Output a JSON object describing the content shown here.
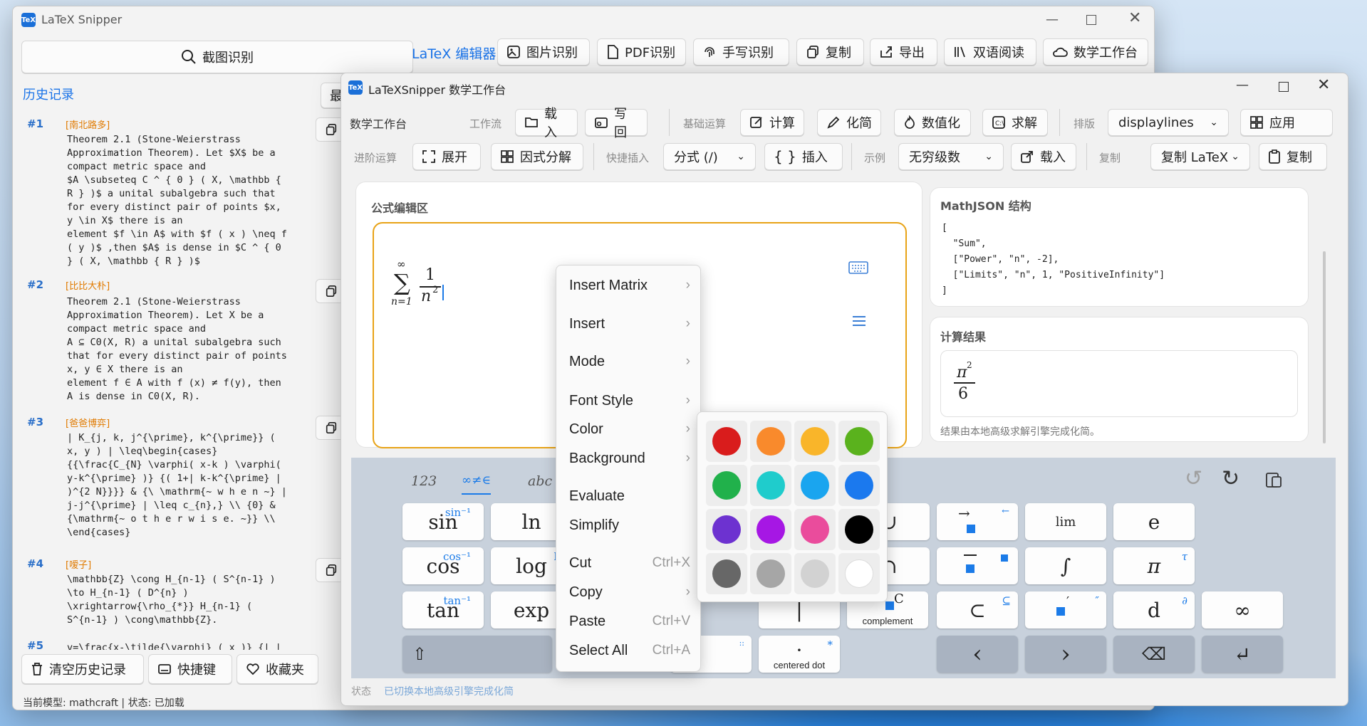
{
  "main": {
    "title": "LaTeX Snipper",
    "capture_btn": "截图识别",
    "editor_link": "LaTeX 编辑器",
    "toolbar": [
      "图片识别",
      "PDF识别",
      "手写识别",
      "复制",
      "导出",
      "双语阅读",
      "数学工作台"
    ],
    "history_title": "历史记录",
    "history_btn_partial": "最",
    "history": [
      {
        "num": "#1",
        "tag": "[南北路多]",
        "text": "Theorem 2.1 (Stone-Weierstrass\nApproximation Theorem). Let $X$ be a\ncompact metric space and\n$A \\subseteq C ^ { 0 } ( X, \\mathbb {\nR } )$ a unital subalgebra such that\nfor every distinct pair of points $x,\ny \\in X$ there is an\nelement $f \\in A$ with $f ( x ) \\neq f\n( y )$ ,then $A$ is dense in $C ^ { 0\n} ( X, \\mathbb { R } )$"
      },
      {
        "num": "#2",
        "tag": "[比比大朴]",
        "text": "Theorem 2.1 (Stone-Weierstrass\nApproximation Theorem). Let X be a\ncompact metric space and\nA ⊆ C0(X, R) a unital subalgebra such\nthat for every distinct pair of points\nx, y ∈ X there is an\nelement f ∈ A with f (x) ≠ f(y), then\nA is dense in C0(X, R)."
      },
      {
        "num": "#3",
        "tag": "[爸爸博弈]",
        "text": "| K_{j, k, j^{\\prime}, k^{\\prime}} (\nx, y ) | \\leq\\begin{cases}\n{{\\frac{C_{N} \\varphi( x-k ) \\varphi(\ny-k^{\\prime} )} {( 1+| k-k^{\\prime} |\n)^{2 N}}}} & {\\ \\mathrm{~ w h e n ~} |\nj-j^{\\prime} | \\leq c_{n},} \\\\ {0} &\n{\\mathrm{~ o t h e r w i s e. ~}} \\\\\n\\end{cases}"
      },
      {
        "num": "#4",
        "tag": "[嗳子]",
        "text": "\\mathbb{Z} \\cong H_{n-1} ( S^{n-1} )\n\\to H_{n-1} ( D^{n} )\n\\xrightarrow{\\rho_{*}} H_{n-1} (\nS^{n-1} ) \\cong\\mathbb{Z}."
      },
      {
        "num": "#5",
        "tag": "",
        "text": "v=\\frac{x-\\tilde{\\varphi} ( x )} {| |"
      }
    ],
    "bottom_btns": [
      "清空历史记录",
      "快捷键",
      "收藏夹"
    ],
    "status": "当前模型: mathcraft | 状态: 已加载"
  },
  "ws": {
    "title": "LaTeXSnipper 数学工作台",
    "row1_title": "数学工作台",
    "lbl_workflow": "工作流",
    "btn_load": "载入",
    "btn_writeback": "写回",
    "lbl_basic": "基础运算",
    "btn_calc": "计算",
    "btn_simplify": "化简",
    "btn_numeric": "数值化",
    "btn_solve": "求解",
    "lbl_layout": "排版",
    "layout_value": "displaylines",
    "btn_apply": "应用",
    "lbl_advanced": "进阶运算",
    "btn_expand": "展开",
    "btn_factor": "因式分解",
    "lbl_quick": "快捷插入",
    "quick_value": "分式 (/)",
    "btn_insert": "插入",
    "lbl_example": "示例",
    "example_value": "无穷级数",
    "btn_load2": "载入",
    "lbl_copy": "复制",
    "copy_value": "复制 LaTeX",
    "btn_copy": "复制",
    "editor_title": "公式编辑区",
    "formula": {
      "top": "∞",
      "sigma": "∑",
      "bottom": "n=1",
      "num": "1",
      "den": "n",
      "exp": "2"
    },
    "mathjson_title": "MathJSON 结构",
    "mathjson": "[\n  \"Sum\",\n  [\"Power\", \"n\", -2],\n  [\"Limits\", \"n\", 1, \"PositiveInfinity\"]\n]",
    "result_title": "计算结果",
    "result": {
      "num": "π",
      "exp": "2",
      "den": "6"
    },
    "result_note": "结果由本地高级求解引擎完成化简。",
    "status_label": "状态",
    "status_text": "已切换本地高级引擎完成化简"
  },
  "kb": {
    "tabs": [
      "123",
      "∞≠∈",
      "abc"
    ],
    "keys": [
      {
        "t": "sin",
        "s": "sin⁻¹"
      },
      {
        "t": "ln",
        "s": ""
      },
      {
        "t": "∪",
        "s": ""
      },
      {
        "t": "",
        "s": ""
      },
      {
        "t": "lim",
        "s": ""
      },
      {
        "t": "e",
        "s": ""
      },
      {
        "t": "cos",
        "s": "cos⁻¹"
      },
      {
        "t": "log",
        "s": "log"
      },
      {
        "t": "∩",
        "s": ""
      },
      {
        "t": "",
        "s": ""
      },
      {
        "t": "∫",
        "s": ""
      },
      {
        "t": "π",
        "s": "τ"
      },
      {
        "t": "tan",
        "s": "tan⁻¹"
      },
      {
        "t": "exp",
        "s": ""
      },
      {
        "t": "⇔",
        "s": ""
      },
      {
        "t": "|",
        "s": ""
      },
      {
        "t": "C",
        "s": ""
      },
      {
        "t": "⊂",
        "s": "⊆"
      },
      {
        "t": "d",
        "s": "∂"
      },
      {
        "t": "∞",
        "s": ""
      },
      {
        "t": "⇧",
        "s": ""
      },
      {
        "t": ":",
        "s": "::"
      },
      {
        "t": "·",
        "s": "*"
      },
      {
        "t": "‹",
        "s": ""
      },
      {
        "t": "›",
        "s": ""
      },
      {
        "t": "⌫",
        "s": ""
      },
      {
        "t": "↵",
        "s": ""
      }
    ],
    "cap_complement": "complement",
    "cap_centered": "centered dot",
    "partial_e": "E",
    "partial_theta": "ϑ",
    "partial_notin": "∉",
    "partial_ni": "∋"
  },
  "menu": {
    "items": [
      {
        "label": "Insert Matrix",
        "sc": "›"
      },
      {
        "label": "Insert",
        "sc": "›"
      },
      {
        "label": "Mode",
        "sc": "›"
      },
      {
        "label": "Font Style",
        "sc": "›"
      },
      {
        "label": "Color",
        "sc": "›"
      },
      {
        "label": "Background",
        "sc": "›"
      },
      {
        "label": "Evaluate",
        "sc": ""
      },
      {
        "label": "Simplify",
        "sc": ""
      },
      {
        "label": "Cut",
        "sc": "Ctrl+X"
      },
      {
        "label": "Copy",
        "sc": "›"
      },
      {
        "label": "Paste",
        "sc": "Ctrl+V"
      },
      {
        "label": "Select All",
        "sc": "Ctrl+A"
      }
    ]
  },
  "colors": [
    "#d91c1c",
    "#f98a2c",
    "#f9b52a",
    "#5ab21d",
    "#21b14b",
    "#1fcccc",
    "#1aa5ef",
    "#1b79ee",
    "#6d32d0",
    "#a617e4",
    "#ea4c9c",
    "#000000",
    "#676767",
    "#a6a6a6",
    "#d2d2d2",
    "#ffffff"
  ]
}
